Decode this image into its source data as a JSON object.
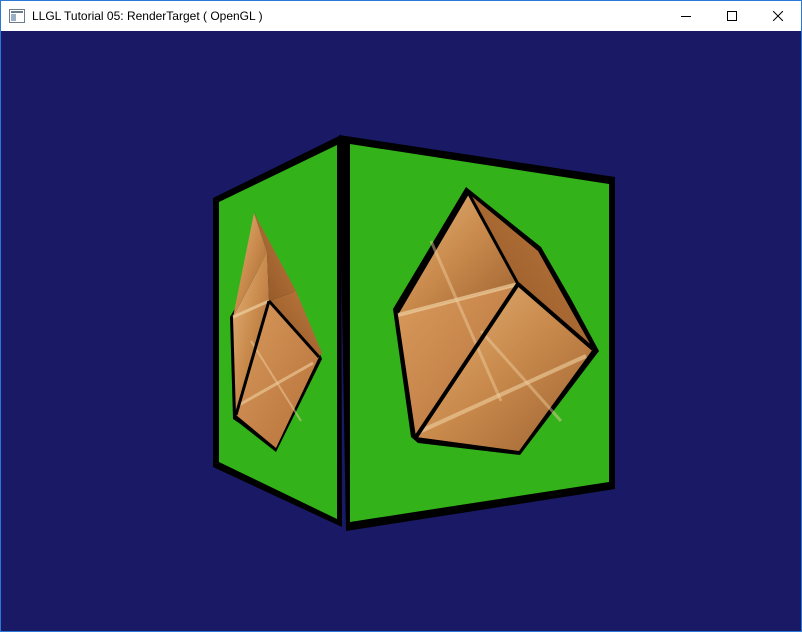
{
  "window": {
    "title": "LLGL Tutorial 05: RenderTarget ( OpenGL )",
    "icon": "app-window-icon",
    "controls": [
      {
        "name": "minimize-button",
        "icon": "minimize-icon"
      },
      {
        "name": "maximize-button",
        "icon": "maximize-icon"
      },
      {
        "name": "close-button",
        "icon": "close-icon"
      }
    ]
  },
  "scene": {
    "clear_color": "#191966",
    "cube_face_color": "#33b21a",
    "edge_color": "#000000",
    "inner_object": "wooden crate cube rendered to texture",
    "crate_colors": [
      "#c9874a",
      "#e0a86b",
      "#8a5424"
    ]
  }
}
